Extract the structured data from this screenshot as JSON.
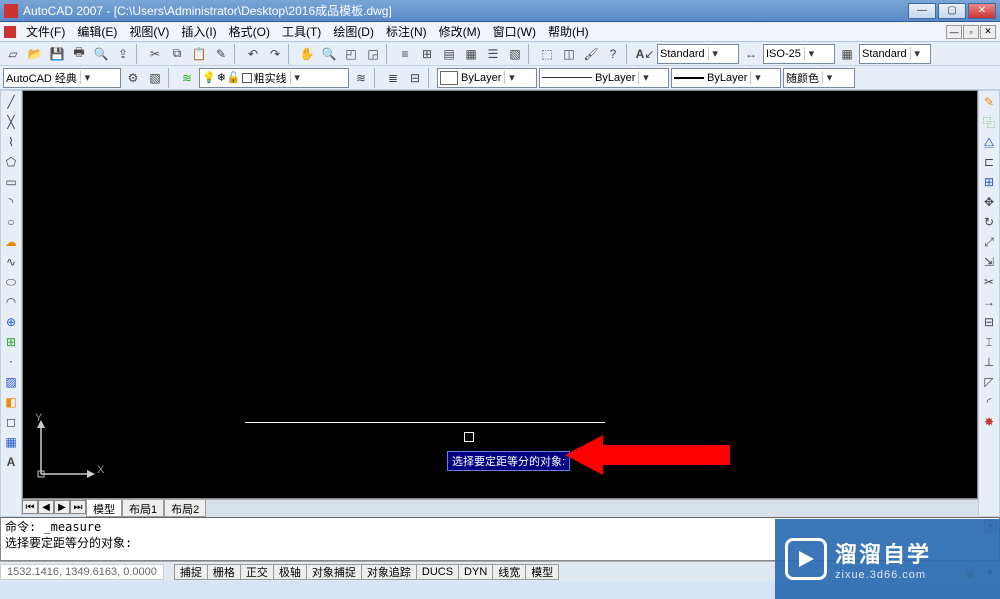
{
  "window": {
    "title": "AutoCAD 2007 - [C:\\Users\\Administrator\\Desktop\\2016成品模板.dwg]"
  },
  "menu": [
    "文件(F)",
    "编辑(E)",
    "视图(V)",
    "插入(I)",
    "格式(O)",
    "工具(T)",
    "绘图(D)",
    "标注(N)",
    "修改(M)",
    "窗口(W)",
    "帮助(H)"
  ],
  "toolbar1": {
    "style_combo": "Standard",
    "dim_combo": "ISO-25",
    "table_combo": "Standard"
  },
  "toolbar2": {
    "workspace": "AutoCAD 经典",
    "layer_state": "粗实线",
    "color_layer": "ByLayer",
    "linetype": "ByLayer",
    "lineweight": "ByLayer",
    "plotstyle": "随颜色"
  },
  "canvas": {
    "tooltip": "选择要定距等分的对象:",
    "ucs_y": "Y",
    "ucs_x": "X",
    "tabs": [
      "模型",
      "布局1",
      "布局2"
    ]
  },
  "cmd": {
    "line1": "命令: _measure",
    "line2": "选择要定距等分的对象:"
  },
  "status": {
    "coords": "1532.1416, 1349.6163, 0.0000",
    "buttons": [
      "捕捉",
      "栅格",
      "正交",
      "极轴",
      "对象捕捉",
      "对象追踪",
      "DUCS",
      "DYN",
      "线宽",
      "模型"
    ]
  },
  "watermark": {
    "title": "溜溜自学",
    "sub": "zixue.3d66.com"
  }
}
